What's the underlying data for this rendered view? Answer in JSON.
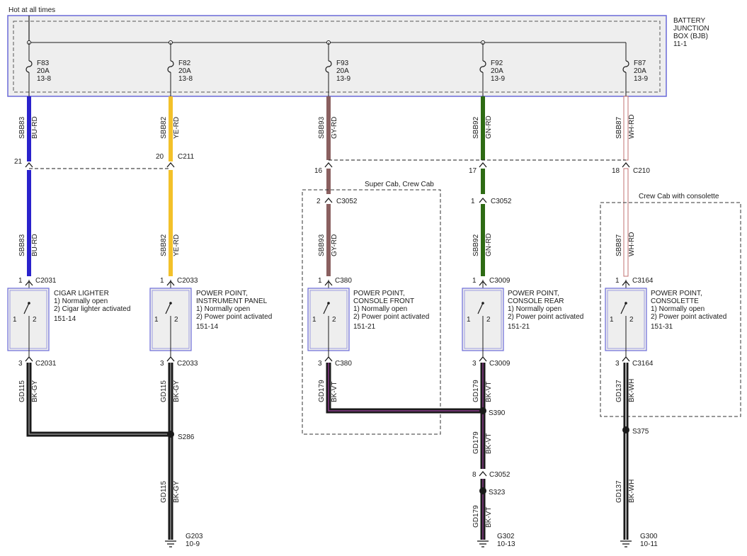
{
  "header": {
    "hot_label": "Hot at all times"
  },
  "bjb": {
    "title_lines": [
      "BATTERY",
      "JUNCTION",
      "BOX (BJB)",
      "11-1"
    ],
    "fill_color": "#eeeeee",
    "border_color": "#6a6ad8"
  },
  "fuses": [
    {
      "id": "F83",
      "rating": "20A",
      "ref": "13-8"
    },
    {
      "id": "F82",
      "rating": "20A",
      "ref": "13-8"
    },
    {
      "id": "F93",
      "rating": "20A",
      "ref": "13-9"
    },
    {
      "id": "F92",
      "rating": "20A",
      "ref": "13-9"
    },
    {
      "id": "F87",
      "rating": "20A",
      "ref": "13-9"
    }
  ],
  "feed_wires": [
    {
      "circuit": "SBB83",
      "color_code": "BU-RD",
      "hex": "#2a22cc"
    },
    {
      "circuit": "SBB82",
      "color_code": "YE-RD",
      "hex": "#f3c12a"
    },
    {
      "circuit": "SBB93",
      "color_code": "GY-RD",
      "hex": "#8a6060"
    },
    {
      "circuit": "SBB92",
      "color_code": "GN-RD",
      "hex": "#2e6b14"
    },
    {
      "circuit": "SBB87",
      "color_code": "WH-RD",
      "hex": "#d9aaaa"
    }
  ],
  "c211": {
    "left_pin": "21",
    "right_pin": "20",
    "label": "C211"
  },
  "c210": {
    "pins": [
      "16",
      "17",
      "18"
    ],
    "label": "C210"
  },
  "c3052_top": [
    {
      "pin": "2",
      "label": "C3052"
    },
    {
      "pin": "1",
      "label": "C3052"
    }
  ],
  "groups": [
    {
      "label": "Super Cab, Crew Cab"
    },
    {
      "label": "Crew Cab with consolette"
    }
  ],
  "devices": [
    {
      "in_pin": "1",
      "in_conn": "C2031",
      "out_pin": "3",
      "out_conn": "C2031",
      "name_lines": [
        "CIGAR LIGHTER"
      ],
      "state1": "1) Normally open",
      "state2": "2) Cigar lighter activated",
      "ref": "151-14"
    },
    {
      "in_pin": "1",
      "in_conn": "C2033",
      "out_pin": "3",
      "out_conn": "C2033",
      "name_lines": [
        "POWER POINT,",
        "INSTRUMENT PANEL"
      ],
      "state1": "1) Normally open",
      "state2": "2) Power point activated",
      "ref": "151-14"
    },
    {
      "in_pin": "1",
      "in_conn": "C380",
      "out_pin": "3",
      "out_conn": "C380",
      "name_lines": [
        "POWER POINT,",
        "CONSOLE FRONT"
      ],
      "state1": "1) Normally open",
      "state2": "2) Power point activated",
      "ref": "151-21"
    },
    {
      "in_pin": "1",
      "in_conn": "C3009",
      "out_pin": "3",
      "out_conn": "C3009",
      "name_lines": [
        "POWER POINT,",
        "CONSOLE REAR"
      ],
      "state1": "1) Normally open",
      "state2": "2) Power point activated",
      "ref": "151-21"
    },
    {
      "in_pin": "1",
      "in_conn": "C3164",
      "out_pin": "3",
      "out_conn": "C3164",
      "name_lines": [
        "POWER POINT,",
        "CONSOLETTE"
      ],
      "state1": "1) Normally open",
      "state2": "2) Power point activated",
      "ref": "151-31"
    }
  ],
  "switch_pins": {
    "left": "1",
    "right": "2"
  },
  "ground_wires": [
    {
      "circuit": "GD115",
      "color_code": "BK-GY",
      "hex": "#1a1a1a",
      "stripe": "#8a8a8a"
    },
    {
      "circuit": "GD179",
      "color_code": "BK-VT",
      "hex": "#1a1a1a",
      "stripe": "#8a3a8a"
    },
    {
      "circuit": "GD137",
      "color_code": "BK-WH",
      "hex": "#1a1a1a",
      "stripe": "#e0e0e0"
    }
  ],
  "splices": {
    "s286": "S286",
    "s390": "S390",
    "s323": "S323",
    "s375": "S375"
  },
  "c3052_bottom": {
    "pin": "8",
    "label": "C3052"
  },
  "grounds": [
    {
      "id": "G203",
      "ref": "10-9"
    },
    {
      "id": "G302",
      "ref": "10-13"
    },
    {
      "id": "G300",
      "ref": "10-11"
    }
  ]
}
